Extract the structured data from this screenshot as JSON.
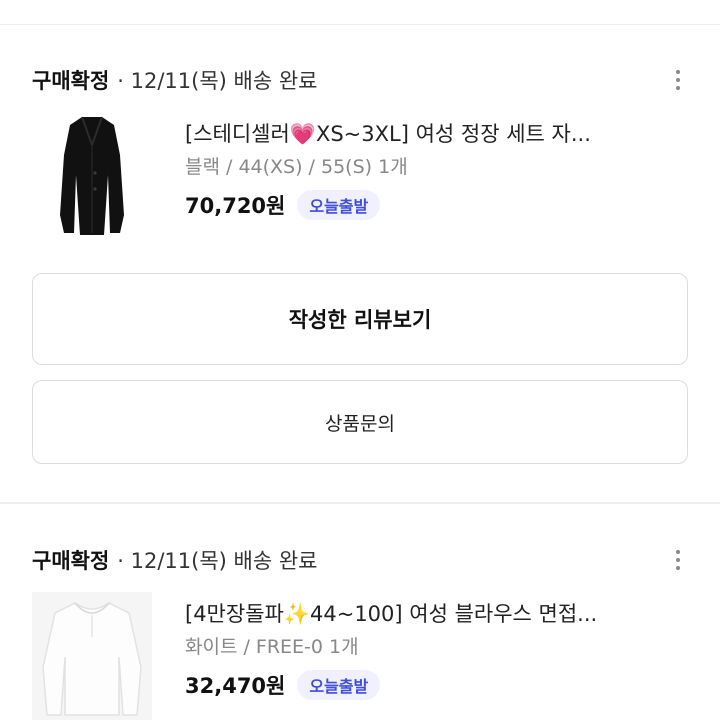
{
  "orders": [
    {
      "status": "구매확정",
      "meta": "· 12/11(목) 배송 완료",
      "title_prefix": "[스테디셀러",
      "title_emoji": "💗",
      "title_suffix": "XS~3XL] 여성 정장 세트 자...",
      "option": "블랙 / 44(XS) / 55(S)   1개",
      "price": "70,720원",
      "badge": "오늘출발",
      "thumb_icon": "black-jacket",
      "buttons": {
        "review": "작성한 리뷰보기",
        "inquiry": "상품문의"
      }
    },
    {
      "status": "구매확정",
      "meta": "· 12/11(목) 배송 완료",
      "title_prefix": "[4만장돌파",
      "title_emoji": "✨",
      "title_suffix": "44~100] 여성 블라우스 면접...",
      "option": "화이트 / FREE-0   1개",
      "price": "32,470원",
      "badge": "오늘출발",
      "thumb_icon": "white-blouse"
    }
  ],
  "colors": {
    "badge_bg": "#f0f0ff",
    "badge_text": "#3d4de0",
    "option_text": "#888888",
    "divider": "#eeeeee"
  }
}
